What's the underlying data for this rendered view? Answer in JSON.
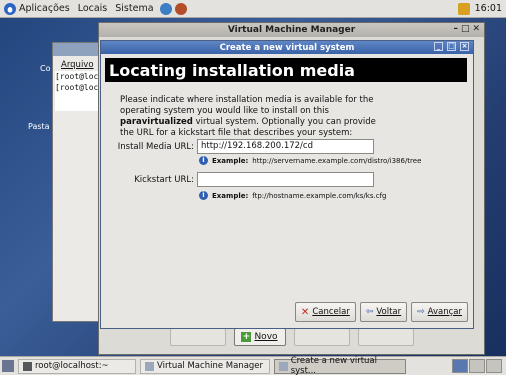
{
  "top_panel": {
    "menus": [
      "Aplicações",
      "Locais",
      "Sistema"
    ],
    "clock": "16:01"
  },
  "desktop": {
    "icon_label": "Pasta"
  },
  "terminal": {
    "menu_label": "Arquivo",
    "lines": [
      "[root@loc",
      "[root@loc"
    ],
    "side_letters": "Co"
  },
  "vmm_window": {
    "title": "Virtual Machine Manager",
    "buttons": {
      "novo": "Novo"
    }
  },
  "dialog": {
    "title": "Create a new virtual system",
    "heading": "Locating installation media",
    "description_parts": [
      "Please indicate where installation media is available for the operating system you would like to install on this ",
      "paravirtualized",
      " virtual system. Optionally you can provide the URL for a kickstart file that describes your system:"
    ],
    "install_media_label": "Install Media URL:",
    "install_media_value": "http://192.168.200.172/cd",
    "install_media_example_label": "Example:",
    "install_media_example": "http://servername.example.com/distro/i386/tree",
    "kickstart_label": "Kickstart URL:",
    "kickstart_value": "",
    "kickstart_example_label": "Example:",
    "kickstart_example": "ftp://hostname.example.com/ks/ks.cfg",
    "buttons": {
      "cancel": "Cancelar",
      "back": "Voltar",
      "forward": "Avançar"
    }
  },
  "taskbar": {
    "tasks": [
      "root@localhost:~",
      "Virtual Machine Manager",
      "Create a new virtual syst..."
    ]
  },
  "colors": {
    "dialog_titlebar": "#3a62a8",
    "banner": "#000000",
    "desktop": "#24467f"
  }
}
